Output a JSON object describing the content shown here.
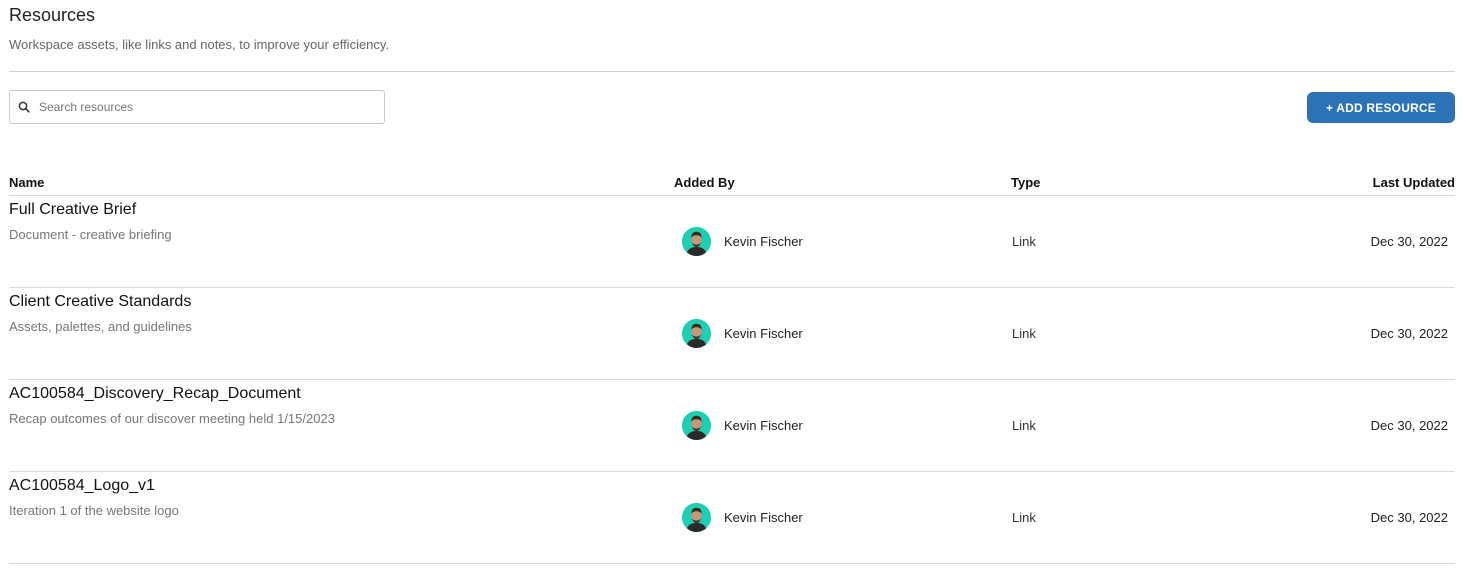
{
  "header": {
    "title": "Resources",
    "subtitle": "Workspace assets, like links and notes, to improve your efficiency."
  },
  "search": {
    "placeholder": "Search resources",
    "icon": "search-icon"
  },
  "add_button": {
    "label": "+ ADD RESOURCE",
    "color": "#2b73b6"
  },
  "table": {
    "columns": [
      "Name",
      "Added By",
      "Type",
      "Last Updated"
    ],
    "rows": [
      {
        "name": "Full Creative Brief",
        "description": "Document - creative briefing",
        "added_by": "Kevin Fischer",
        "type": "Link",
        "last_updated": "Dec 30, 2022"
      },
      {
        "name": "Client Creative Standards",
        "description": "Assets, palettes, and guidelines",
        "added_by": "Kevin Fischer",
        "type": "Link",
        "last_updated": "Dec 30, 2022"
      },
      {
        "name": "AC100584_Discovery_Recap_Document",
        "description": "Recap outcomes of our discover meeting held 1/15/2023",
        "added_by": "Kevin Fischer",
        "type": "Link",
        "last_updated": "Dec 30, 2022"
      },
      {
        "name": "AC100584_Logo_v1",
        "description": "Iteration 1 of the website logo",
        "added_by": "Kevin Fischer",
        "type": "Link",
        "last_updated": "Dec 30, 2022"
      }
    ]
  },
  "avatar_color": "#1fcfb4"
}
